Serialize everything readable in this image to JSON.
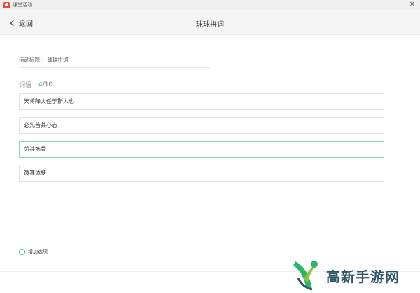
{
  "window": {
    "title": "课堂活动",
    "close_glyph": "✕"
  },
  "header": {
    "back_label": "返回",
    "title": "球球拼词"
  },
  "form": {
    "title_label": "活动标题：",
    "title_value": "球球拼词",
    "words_label": "词语",
    "words_current": "4",
    "words_total": "/10",
    "words": [
      "天将降大任于斯人也",
      "必先苦其心志",
      "劳其筋骨",
      "饿其体肤"
    ],
    "add_option_label": "增加选项"
  },
  "watermark": {
    "text": "高新手游网",
    "logo": "gaoxin-logo-icon"
  },
  "colors": {
    "accent": "#2fb56a",
    "active_border": "#8fd9b0",
    "brand_text": "#2f5468"
  }
}
